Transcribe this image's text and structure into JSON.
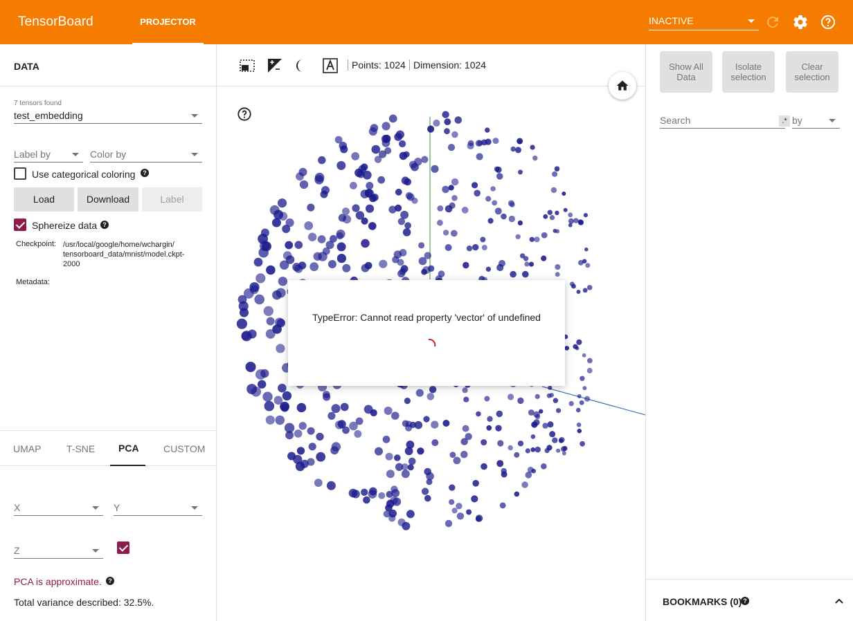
{
  "topbar": {
    "brand": "TensorBoard",
    "tab": "PROJECTOR",
    "run_select": "INACTIVE",
    "colors": {
      "bar": "#f57c00",
      "text": "#ffffff"
    },
    "icons": [
      "refresh-icon",
      "settings-icon",
      "help-icon"
    ]
  },
  "left": {
    "title": "DATA",
    "tensors_found": "7 tensors found",
    "tensor": "test_embedding",
    "label_by": "Label by",
    "color_by": "Color by",
    "categorical": "Use categorical coloring",
    "buttons": {
      "load": "Load",
      "download": "Download",
      "label": "Label"
    },
    "sphereize": "Sphereize data",
    "checkpoint_label": "Checkpoint:",
    "checkpoint_lines": [
      "/usr/local/google/home/wchargin/",
      "tensorboard_data/mnist/model.ckpt-",
      "2000"
    ],
    "metadata_label": "Metadata:",
    "tabs": [
      "UMAP",
      "T-SNE",
      "PCA",
      "CUSTOM"
    ],
    "active_tab": "PCA",
    "pca": {
      "x": "X",
      "y": "Y",
      "z": "Z",
      "approx": "PCA is approximate.",
      "variance": "Total variance described: 32.5%.",
      "approx_color": "#8e1b4a"
    }
  },
  "center": {
    "points": "Points: 1024",
    "dimension": "Dimension: 1024",
    "tool_icons": [
      "selection-icon",
      "night-mode-icon",
      "contrast-icon",
      "label-icon"
    ],
    "dialog_message": "TypeError: Cannot read property 'vector' of undefined",
    "point_color": "#1a1a8c"
  },
  "right": {
    "show_all": "Show All Data",
    "isolate": "Isolate selection",
    "clear": "Clear selection",
    "search_placeholder": "Search",
    "regex": ".*",
    "by": "by",
    "bookmarks": "BOOKMARKS (0)"
  }
}
